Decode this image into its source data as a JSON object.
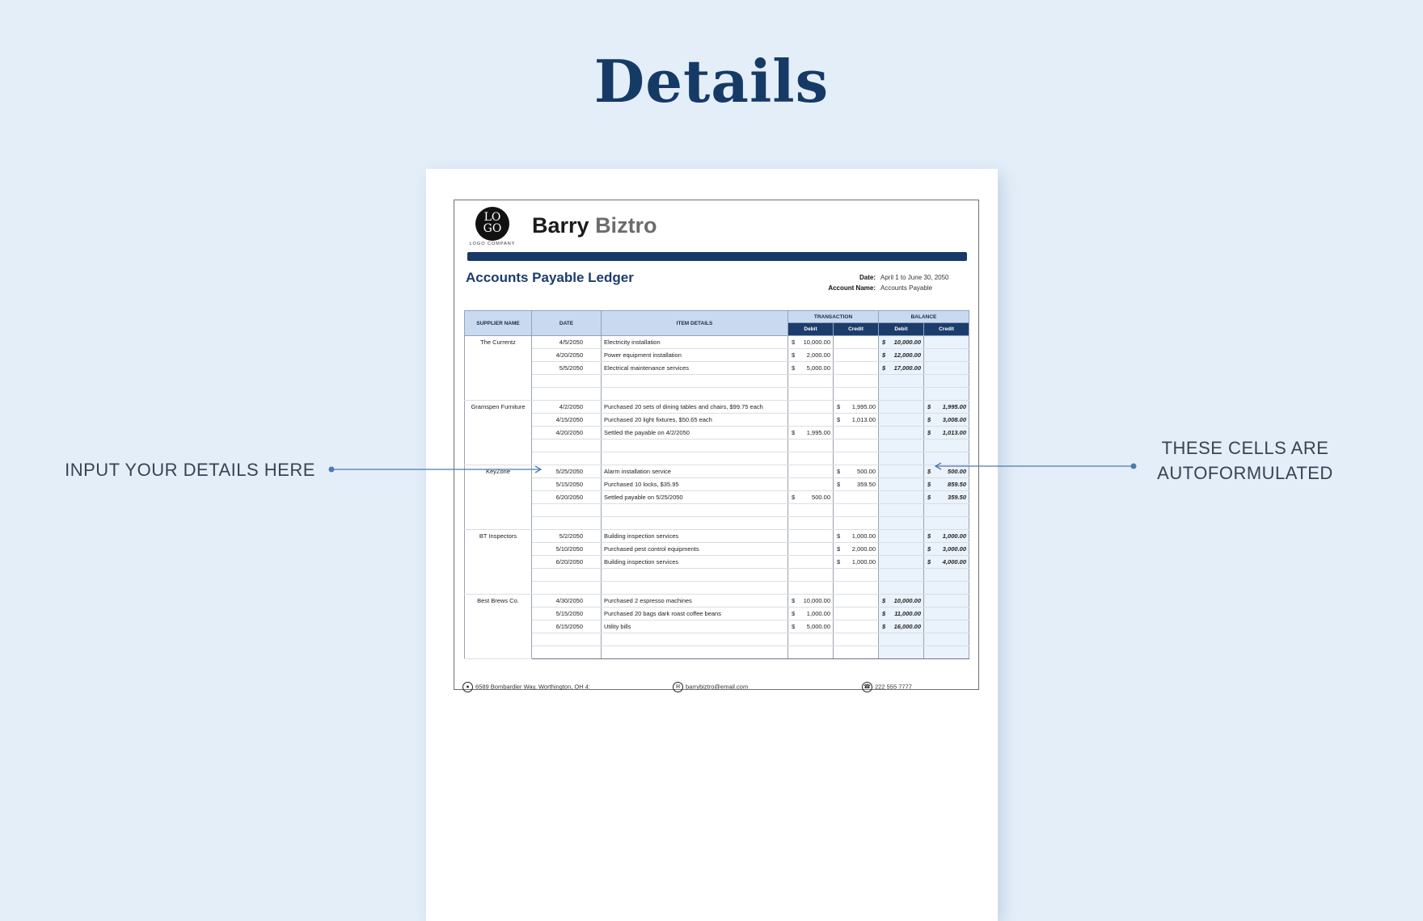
{
  "page": {
    "title": "Details",
    "callout_left": "INPUT YOUR DETAILS HERE",
    "callout_right_line1": "THESE CELLS ARE",
    "callout_right_line2": "AUTOFORMULATED"
  },
  "document": {
    "logo_line1": "LO",
    "logo_line2": "GO",
    "logo_caption": "LOGO COMPANY",
    "company_first": "Barry",
    "company_last": "Biztro",
    "ledger_title": "Accounts Payable Ledger",
    "date_label": "Date:",
    "date_value": "April 1 to June 30, 2050",
    "account_label": "Account Name:",
    "account_value": "Accounts Payable",
    "headers": {
      "supplier": "SUPPLIER NAME",
      "date": "DATE",
      "item": "ITEM DETAILS",
      "transaction": "TRANSACTION",
      "balance": "BALANCE",
      "debit": "Debit",
      "credit": "Credit"
    },
    "currency": "$",
    "groups": [
      {
        "supplier": "The Currentz",
        "rows": [
          {
            "date": "4/5/2050",
            "item": "Electricity installation",
            "t_debit": "10,000.00",
            "t_credit": "",
            "b_debit": "10,000.00",
            "b_credit": ""
          },
          {
            "date": "4/20/2050",
            "item": "Power equipment installation",
            "t_debit": "2,000.00",
            "t_credit": "",
            "b_debit": "12,000.00",
            "b_credit": ""
          },
          {
            "date": "5/5/2050",
            "item": "Electrical maintenance services",
            "t_debit": "5,000.00",
            "t_credit": "",
            "b_debit": "17,000.00",
            "b_credit": ""
          }
        ]
      },
      {
        "supplier": "Gramspen Furniture",
        "rows": [
          {
            "date": "4/2/2050",
            "item": "Purchased 20 sets of dining tables and chairs, $99.75 each",
            "t_debit": "",
            "t_credit": "1,995.00",
            "b_debit": "",
            "b_credit": "1,995.00"
          },
          {
            "date": "4/15/2050",
            "item": "Purchased 20 light fixtures, $50.65 each",
            "t_debit": "",
            "t_credit": "1,013.00",
            "b_debit": "",
            "b_credit": "3,008.00"
          },
          {
            "date": "4/20/2050",
            "item": "Settled the payable on 4/2/2050",
            "t_debit": "1,995.00",
            "t_credit": "",
            "b_debit": "",
            "b_credit": "1,013.00"
          }
        ]
      },
      {
        "supplier": "KeyZone",
        "rows": [
          {
            "date": "5/25/2050",
            "item": "Alarm installation service",
            "t_debit": "",
            "t_credit": "500.00",
            "b_debit": "",
            "b_credit": "500.00"
          },
          {
            "date": "5/15/2050",
            "item": "Purchased 10 locks, $35.95",
            "t_debit": "",
            "t_credit": "359.50",
            "b_debit": "",
            "b_credit": "859.50"
          },
          {
            "date": "6/20/2050",
            "item": "Settled payable on 5/25/2050",
            "t_debit": "500.00",
            "t_credit": "",
            "b_debit": "",
            "b_credit": "359.50"
          }
        ]
      },
      {
        "supplier": "BT Inspectors",
        "rows": [
          {
            "date": "5/2/2050",
            "item": "Building inspection services",
            "t_debit": "",
            "t_credit": "1,000.00",
            "b_debit": "",
            "b_credit": "1,000.00"
          },
          {
            "date": "5/10/2050",
            "item": "Purchased pest control equipments",
            "t_debit": "",
            "t_credit": "2,000.00",
            "b_debit": "",
            "b_credit": "3,000.00"
          },
          {
            "date": "6/20/2050",
            "item": "Building inspection services",
            "t_debit": "",
            "t_credit": "1,000.00",
            "b_debit": "",
            "b_credit": "4,000.00"
          }
        ]
      },
      {
        "supplier": "Best Brews Co.",
        "rows": [
          {
            "date": "4/30/2050",
            "item": "Purchased 2 espresso machines",
            "t_debit": "10,000.00",
            "t_credit": "",
            "b_debit": "10,000.00",
            "b_credit": ""
          },
          {
            "date": "5/15/2050",
            "item": "Purchased 20 bags dark roast coffee beans",
            "t_debit": "1,000.00",
            "t_credit": "",
            "b_debit": "11,000.00",
            "b_credit": ""
          },
          {
            "date": "6/15/2050",
            "item": "Utility bills",
            "t_debit": "5,000.00",
            "t_credit": "",
            "b_debit": "16,000.00",
            "b_credit": ""
          }
        ]
      }
    ],
    "footer": {
      "address": "6589 Bombardier Way, Worthington, OH 4:",
      "email": "barrybiztro@email.com",
      "phone": "222 555 7777"
    },
    "icons": {
      "address": "location-pin-icon",
      "email": "email-icon",
      "phone": "phone-icon"
    }
  }
}
